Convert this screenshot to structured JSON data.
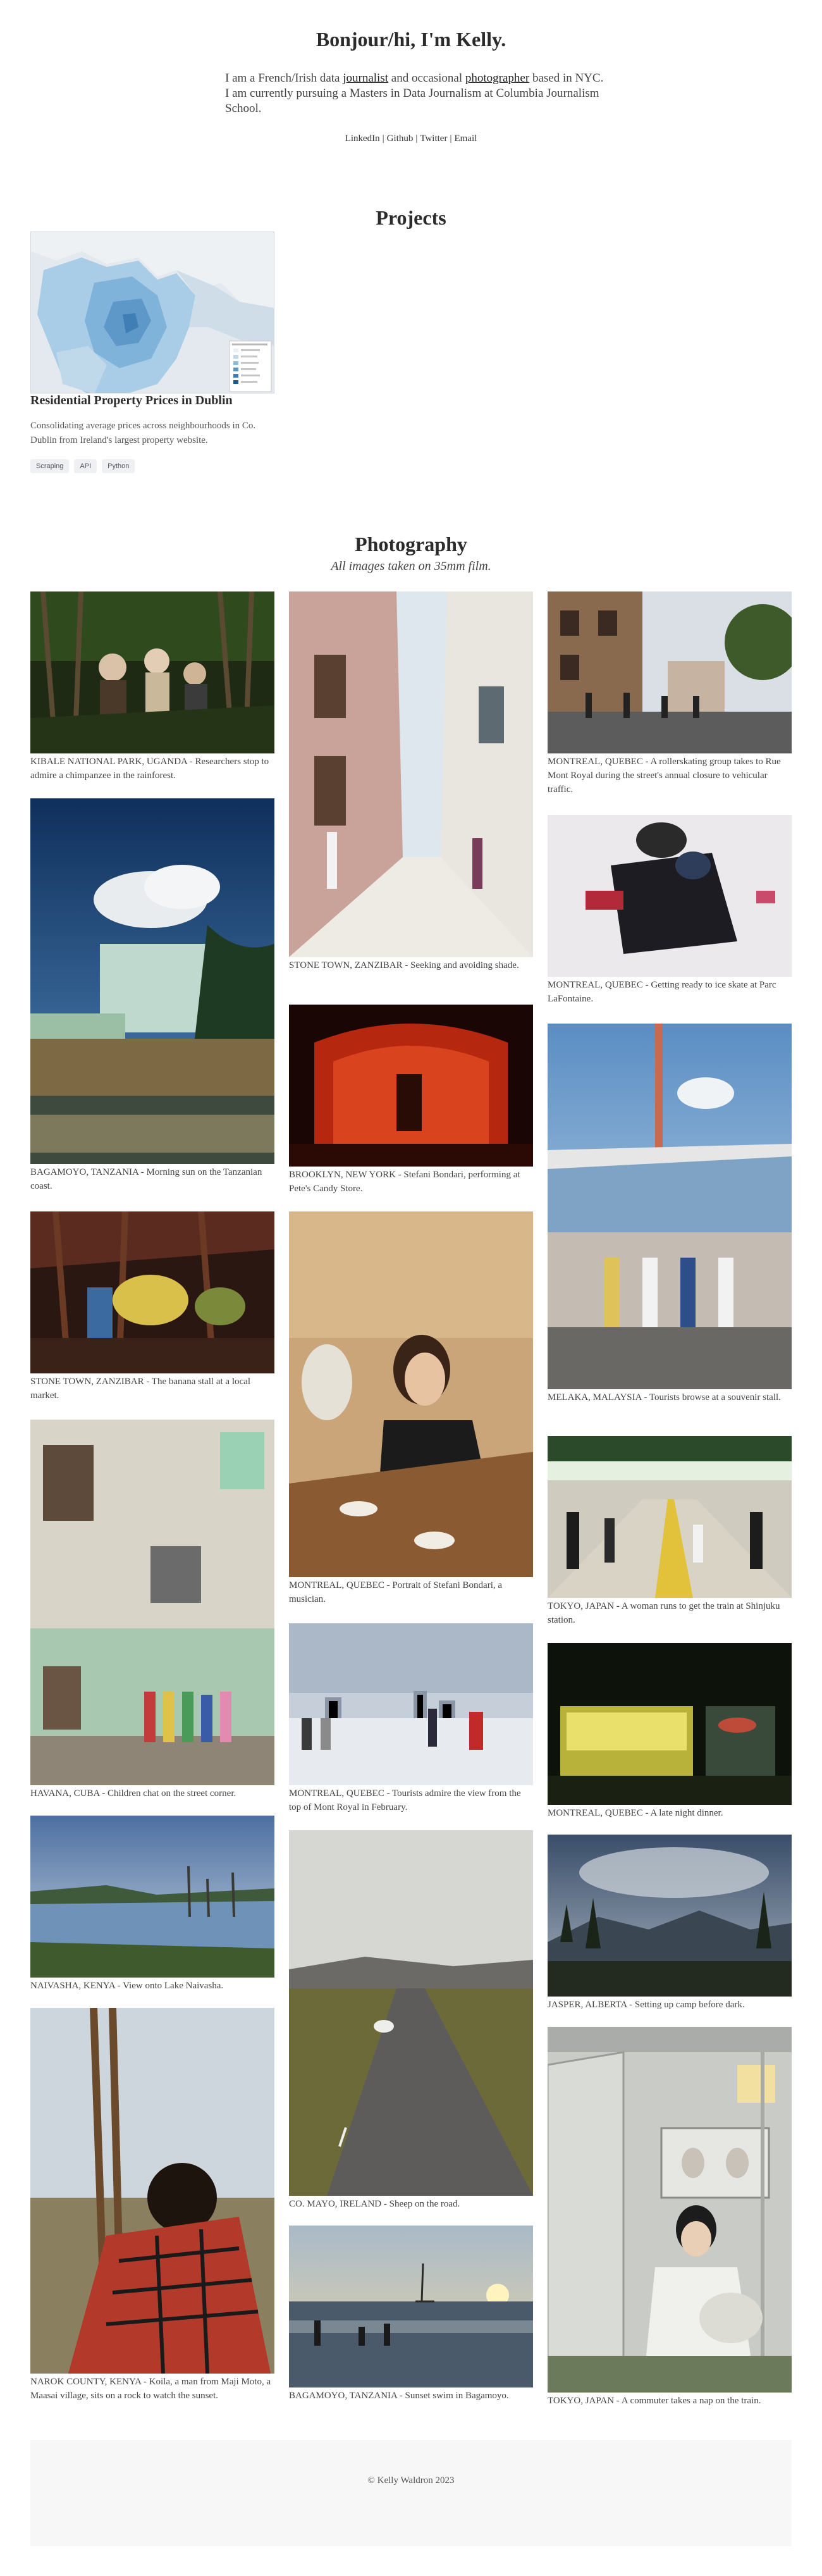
{
  "intro": {
    "title": "Bonjour/hi, I'm Kelly.",
    "text_1": "I am a French/Irish data ",
    "link_journalist": "journalist",
    "text_2": " and occasional ",
    "link_photographer": "photographer",
    "text_3": " based in NYC. I am currently pursuing a Masters in Data Journalism at Columbia Journalism School.",
    "social": [
      "LinkedIn",
      "Github",
      "Twitter",
      "Email"
    ],
    "separator": "|"
  },
  "projects": {
    "title": "Projects",
    "items": [
      {
        "title": "Residential Property Prices in Dublin",
        "description": "Consolidating average prices across neighbourhoods in Co. Dublin from Ireland's largest property website.",
        "tags": [
          "Scraping",
          "API",
          "Python"
        ]
      }
    ]
  },
  "photography": {
    "title": "Photography",
    "subtitle": "All images taken on 35mm film.",
    "photos": [
      {
        "caption": "KIBALE NATIONAL PARK, UGANDA - Researchers stop to admire a chimpanzee in the rainforest."
      },
      {
        "caption": "BAGAMOYO, TANZANIA - Morning sun on the Tanzanian coast."
      },
      {
        "caption": "STONE TOWN, ZANZIBAR - The banana stall at a local market."
      },
      {
        "caption": "HAVANA, CUBA - Children chat on the street corner."
      },
      {
        "caption": "NAIVASHA, KENYA - View onto Lake Naivasha."
      },
      {
        "caption": "NAROK COUNTY, KENYA - Koila, a man from Maji Moto, a Maasai village, sits on a rock to watch the sunset."
      },
      {
        "caption": "STONE TOWN, ZANZIBAR - Seeking and avoiding shade."
      },
      {
        "caption": "BROOKLYN, NEW YORK - Stefani Bondari, performing at Pete's Candy Store."
      },
      {
        "caption": "MONTREAL, QUEBEC - Portrait of Stefani Bondari, a musician."
      },
      {
        "caption": "MONTREAL, QUEBEC - Tourists admire the view from the top of Mont Royal in February."
      },
      {
        "caption": "CO. MAYO, IRELAND - Sheep on the road."
      },
      {
        "caption": "BAGAMOYO, TANZANIA - Sunset swim in Bagamoyo."
      },
      {
        "caption": "MONTREAL, QUEBEC - A rollerskating group takes to Rue Mont Royal during the street's annual closure to vehicular traffic."
      },
      {
        "caption": "MONTREAL, QUEBEC - Getting ready to ice skate at Parc LaFontaine."
      },
      {
        "caption": "MELAKA, MALAYSIA - Tourists browse at a souvenir stall."
      },
      {
        "caption": "TOKYO, JAPAN - A woman runs to get the train at Shinjuku station."
      },
      {
        "caption": "MONTREAL, QUEBEC - A late night dinner."
      },
      {
        "caption": "JASPER, ALBERTA - Setting up camp before dark."
      },
      {
        "caption": "TOKYO, JAPAN - A commuter takes a nap on the train."
      }
    ]
  },
  "footer": {
    "text": "© Kelly Waldron 2023"
  }
}
